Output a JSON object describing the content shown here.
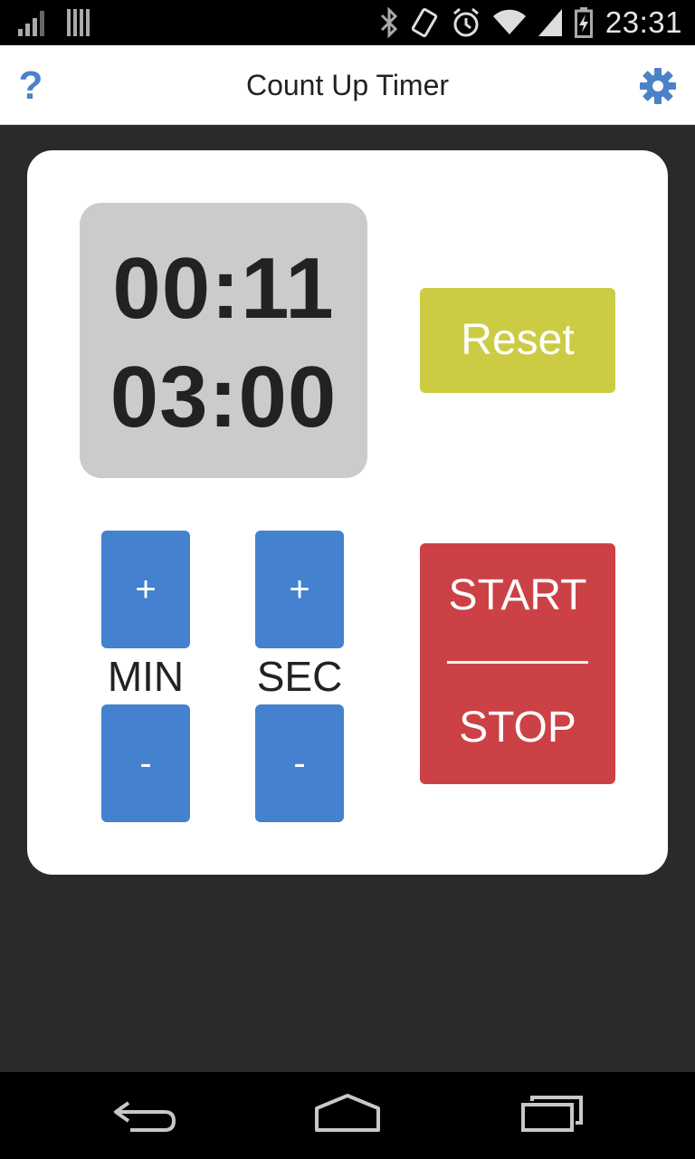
{
  "status_bar": {
    "time": "23:31",
    "icons": [
      "signal-bars-icon",
      "sim-card-icon",
      "bluetooth-icon",
      "vibrate-icon",
      "alarm-icon",
      "wifi-icon",
      "cell-signal-icon",
      "battery-charging-icon"
    ]
  },
  "app_bar": {
    "title": "Count Up Timer",
    "help_label": "?",
    "settings_icon": "gear-icon",
    "accent_color": "#4a82c7"
  },
  "timer": {
    "elapsed": "00:11",
    "target": "03:00"
  },
  "controls": {
    "reset_label": "Reset",
    "min_plus": "+",
    "min_minus": "-",
    "sec_plus": "+",
    "sec_minus": "-",
    "min_label": "MIN",
    "sec_label": "SEC",
    "start_label": "START",
    "stop_label": "STOP"
  },
  "colors": {
    "reset": "#cccc44",
    "plus_minus": "#4481cf",
    "start_stop": "#cc4145",
    "display_bg": "#cbcbcb",
    "page_bg": "#2a2a2a"
  },
  "nav_bar": {
    "icons": [
      "back-icon",
      "home-icon",
      "recent-apps-icon"
    ]
  }
}
